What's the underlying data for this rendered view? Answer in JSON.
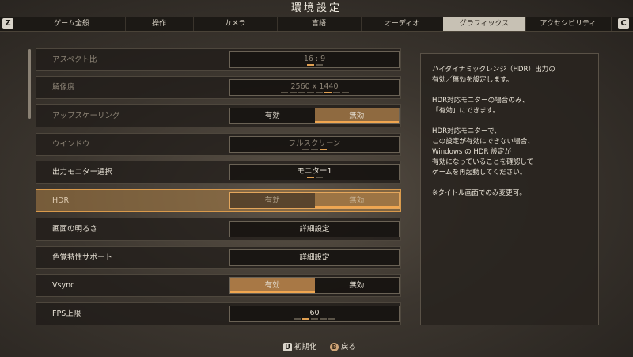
{
  "title": "環境設定",
  "bumpers": {
    "left": "Z",
    "right": "C"
  },
  "tabs": [
    {
      "label": "ゲーム全般",
      "active": false
    },
    {
      "label": "操作",
      "active": false
    },
    {
      "label": "カメラ",
      "active": false
    },
    {
      "label": "言語",
      "active": false
    },
    {
      "label": "オーディオ",
      "active": false
    },
    {
      "label": "グラフィックス",
      "active": true
    },
    {
      "label": "アクセシビリティ",
      "active": false
    }
  ],
  "settings": [
    {
      "label": "アスペクト比",
      "value": "16 : 9",
      "type": "selector",
      "dim": true
    },
    {
      "label": "解像度",
      "value": "2560 x 1440",
      "type": "selector",
      "dim": true
    },
    {
      "label": "アップスケーリング",
      "on": "有効",
      "off": "無効",
      "selected": "off",
      "type": "toggle",
      "dim": true
    },
    {
      "label": "ウインドウ",
      "value": "フルスクリーン",
      "type": "selector",
      "dim": true
    },
    {
      "label": "出力モニター選択",
      "value": "モニター1",
      "type": "selector",
      "dim": false
    },
    {
      "label": "HDR",
      "on": "有効",
      "off": "無効",
      "selected": "off",
      "type": "toggle",
      "focused": true
    },
    {
      "label": "画面の明るさ",
      "value": "詳細設定",
      "type": "button",
      "dim": false
    },
    {
      "label": "色覚特性サポート",
      "value": "詳細設定",
      "type": "button",
      "dim": false
    },
    {
      "label": "Vsync",
      "on": "有効",
      "off": "無効",
      "selected": "on",
      "type": "toggle",
      "dim": false
    },
    {
      "label": "FPS上限",
      "value": "60",
      "type": "selector",
      "dim": false
    }
  ],
  "info": {
    "paragraphs": [
      "ハイダイナミックレンジ（HDR）出力の\n有効／無効を設定します。",
      "HDR対応モニターの場合のみ、\n「有効」にできます。",
      "HDR対応モニターで、\nこの設定が有効にできない場合、\nWindows の HDR 設定が\n有効になっていることを確認して\nゲームを再起動してください。",
      "※タイトル画面でのみ変更可。"
    ]
  },
  "footer": {
    "reset_key": "U",
    "reset_label": "初期化",
    "back_key": "B",
    "back_label": "戻る"
  },
  "colors": {
    "accent": "#f0a650",
    "selected_fill": "#a87845"
  }
}
